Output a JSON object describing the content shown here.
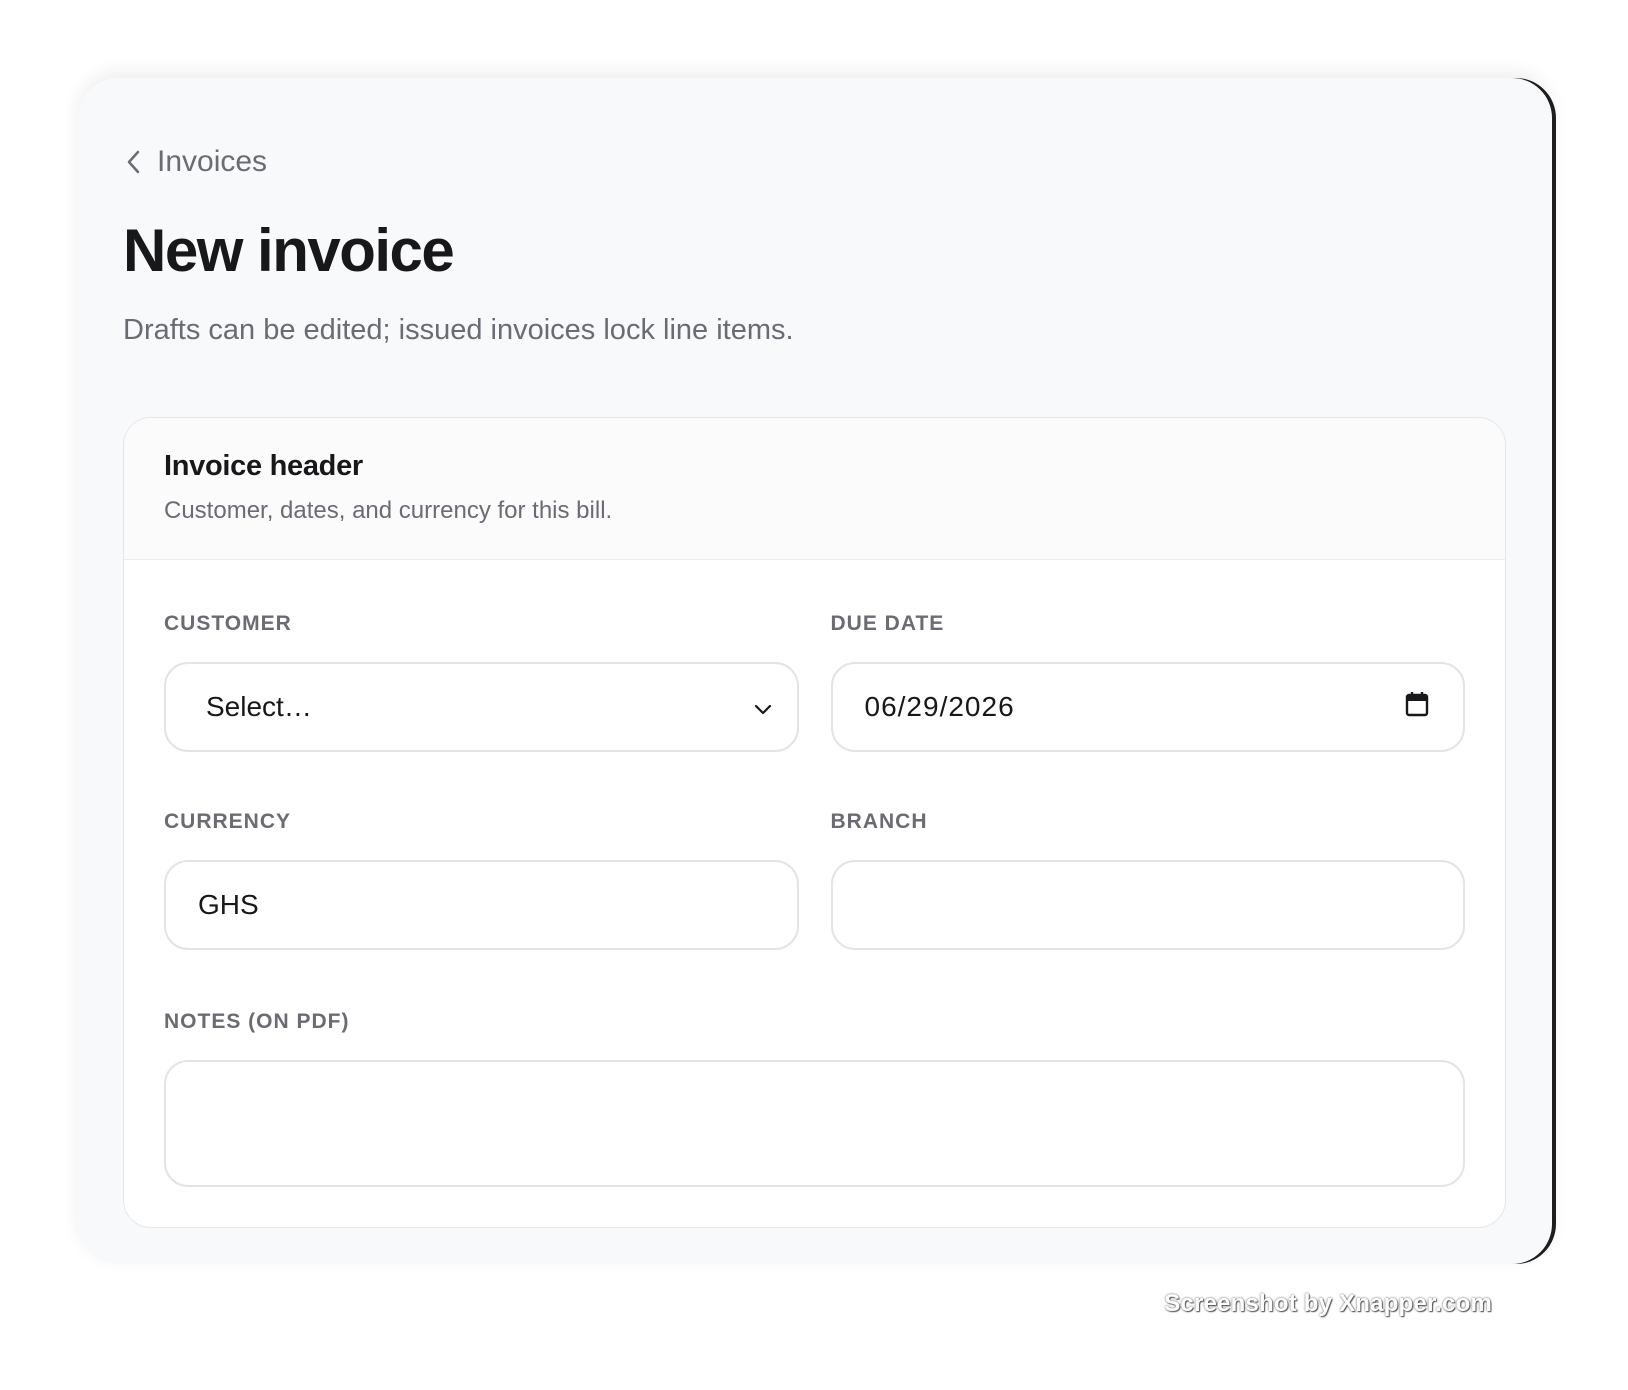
{
  "breadcrumb": {
    "label": "Invoices",
    "icon": "chevron-left-icon"
  },
  "page": {
    "title": "New invoice",
    "subtitle": "Drafts can be edited; issued invoices lock line items."
  },
  "card": {
    "title": "Invoice header",
    "subtitle": "Customer, dates, and currency for this bill."
  },
  "fields": {
    "customer": {
      "label": "CUSTOMER",
      "value": "Select…"
    },
    "due_date": {
      "label": "DUE DATE",
      "value": "06/29/2026"
    },
    "currency": {
      "label": "CURRENCY",
      "value": "GHS"
    },
    "branch": {
      "label": "BRANCH",
      "value": ""
    },
    "notes": {
      "label": "NOTES (ON PDF)",
      "value": ""
    }
  },
  "watermark": "Screenshot by Xnapper.com"
}
